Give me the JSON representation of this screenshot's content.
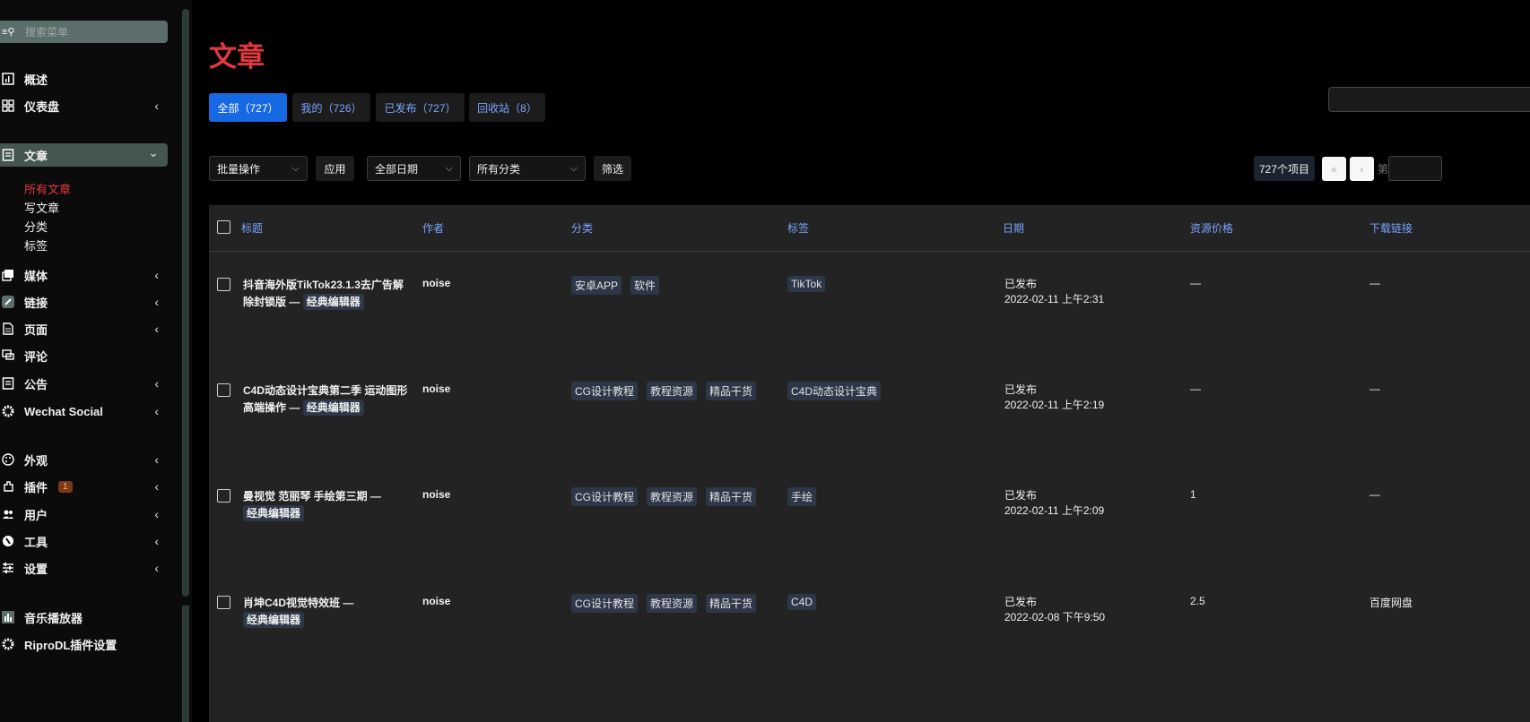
{
  "sidebar": {
    "search_placeholder": "搜索菜单",
    "items": [
      {
        "label": "概述",
        "icon": "chart-icon"
      },
      {
        "label": "仪表盘",
        "icon": "grid-icon",
        "chev": "‹"
      },
      {
        "label": "文章",
        "icon": "document-icon",
        "chev": "⌄"
      },
      {
        "label": "媒体",
        "icon": "media-icon",
        "chev": "‹"
      },
      {
        "label": "链接",
        "icon": "link-icon",
        "chev": "‹"
      },
      {
        "label": "页面",
        "icon": "page-icon",
        "chev": "‹"
      },
      {
        "label": "评论",
        "icon": "comment-icon"
      },
      {
        "label": "公告",
        "icon": "notice-icon",
        "chev": "‹"
      },
      {
        "label": "Wechat Social",
        "icon": "gear-icon",
        "chev": "‹"
      },
      {
        "label": "外观",
        "icon": "palette-icon",
        "chev": "‹"
      },
      {
        "label": "插件",
        "icon": "plugin-icon",
        "chev": "‹",
        "badge": "1"
      },
      {
        "label": "用户",
        "icon": "users-icon",
        "chev": "‹"
      },
      {
        "label": "工具",
        "icon": "wrench-icon",
        "chev": "‹"
      },
      {
        "label": "设置",
        "icon": "sliders-icon",
        "chev": "‹"
      },
      {
        "label": "音乐播放器",
        "icon": "music-chart-icon"
      },
      {
        "label": "RiproDL插件设置",
        "icon": "gear-icon"
      }
    ],
    "submenu": [
      "所有文章",
      "写文章",
      "分类",
      "标签"
    ]
  },
  "page_title": "文章",
  "views": [
    "全部（727）",
    "我的（726）",
    "已发布（727）",
    "回收站（8）"
  ],
  "filters": {
    "bulk_action": "批量操作",
    "apply": "应用",
    "date": "全部日期",
    "category": "所有分类",
    "filter": "筛选",
    "count": "727个项目",
    "first_page": "«",
    "prev_page": "‹",
    "page_prefix": "第"
  },
  "table": {
    "headers": [
      "标题",
      "作者",
      "分类",
      "标签",
      "日期",
      "资源价格",
      "下载链接"
    ],
    "rows": [
      {
        "title": "抖音海外版TikTok23.1.3去广告解除封锁版 —",
        "state": "经典编辑器",
        "author": "noise",
        "categories": [
          "安卓APP",
          "软件"
        ],
        "tags": [
          "TikTok"
        ],
        "status": "已发布",
        "date": "2022-02-11 上午2:31",
        "price": "—",
        "download": "—"
      },
      {
        "title": "C4D动态设计宝典第二季 运动图形高端操作 —",
        "state": "经典编辑器",
        "author": "noise",
        "categories": [
          "CG设计教程",
          "教程资源",
          "精品干货"
        ],
        "tags": [
          "C4D动态设计宝典"
        ],
        "status": "已发布",
        "date": "2022-02-11 上午2:19",
        "price": "—",
        "download": "—"
      },
      {
        "title": "曼视觉 范丽琴 手绘第三期 —",
        "state": "经典编辑器",
        "author": "noise",
        "categories": [
          "CG设计教程",
          "教程资源",
          "精品干货"
        ],
        "tags": [
          "手绘"
        ],
        "status": "已发布",
        "date": "2022-02-11 上午2:09",
        "price": "1",
        "download": "—"
      },
      {
        "title": "肖坤C4D视觉特效班 —",
        "state": "经典编辑器",
        "author": "noise",
        "categories": [
          "CG设计教程",
          "教程资源",
          "精品干货"
        ],
        "tags": [
          "C4D"
        ],
        "status": "已发布",
        "date": "2022-02-08 下午9:50",
        "price": "2.5",
        "download": "百度网盘"
      }
    ]
  },
  "colors": {
    "accent_red": "#e2383f",
    "primary_blue": "#1668e3",
    "link_blue": "#7aa5ff"
  }
}
